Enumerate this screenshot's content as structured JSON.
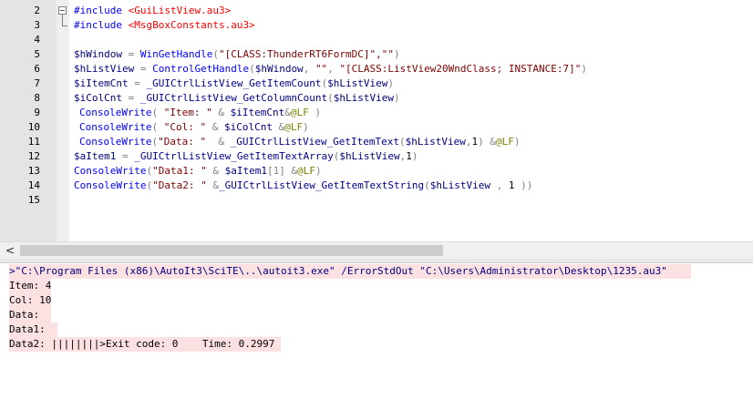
{
  "editor": {
    "line_numbers": [
      "2",
      "3",
      "4",
      "5",
      "6",
      "7",
      "8",
      "9",
      "10",
      "11",
      "12",
      "13",
      "14",
      "15"
    ],
    "lines": {
      "l2": {
        "kw": "#include",
        "sp": " ",
        "str": "<GuiListView.au3>"
      },
      "l3": {
        "kw": "#include",
        "sp": " ",
        "str": "<MsgBoxConstants.au3>"
      },
      "l5": {
        "v": "$hWindow",
        "op": " = ",
        "fn": "WinGetHandle",
        "p1": "(",
        "s": "\"[CLASS:ThunderRT6FormDC]\",\"\"",
        "p2": ")"
      },
      "l6": {
        "v": "$hListView",
        "op": " = ",
        "fn": "ControlGetHandle",
        "p1": "(",
        "v2": "$hWindow",
        "c1": ", ",
        "s1": "\"\"",
        "c2": ", ",
        "s2": "\"[CLASS:ListView20WndClass; INSTANCE:7]\"",
        "p2": ")"
      },
      "l7": {
        "v": "$iItemCnt",
        "op": " = ",
        "fn": "_GUICtrlListView_GetItemCount",
        "p1": "(",
        "v2": "$hListView",
        "p2": ")"
      },
      "l8": {
        "v": "$iColCnt",
        "op": " = ",
        "fn": "_GUICtrlListView_GetColumnCount",
        "p1": "(",
        "v2": "$hListView",
        "p2": ")"
      },
      "l9": {
        "fn": "ConsoleWrite",
        "p1": "( ",
        "s": "\"Item: \"",
        "c1": " & ",
        "v": "$iItemCnt",
        "c2": "&",
        "m": "@LF",
        "p2": " )"
      },
      "l10": {
        "fn": "ConsoleWrite",
        "p1": "( ",
        "s": "\"Col: \"",
        "c1": " & ",
        "v": "$iColCnt",
        "c2": " &",
        "m": "@LF",
        "p2": ")"
      },
      "l11": {
        "fn": "ConsoleWrite",
        "p1": "(",
        "s": "\"Data: \"",
        "c1": "  & ",
        "fn2": "_GUICtrlListView_GetItemText",
        "p3": "(",
        "v": "$hListView",
        "c3": ",",
        "n": "1",
        "p4": ")",
        "c2": " &",
        "m": "@LF",
        "p2": ")"
      },
      "l12": {
        "v": "$aItem1",
        "op": " = ",
        "fn": "_GUICtrlListView_GetItemTextArray",
        "p1": "(",
        "v2": "$hListView",
        "c1": ",",
        "n": "1",
        "p2": ")"
      },
      "l13": {
        "fn": "ConsoleWrite",
        "p1": "(",
        "s": "\"Data1: \"",
        "c1": " & ",
        "v": "$aItem1",
        "b": "[1]",
        "c2": " &",
        "m": "@LF",
        "p2": ")"
      },
      "l14": {
        "fn": "ConsoleWrite",
        "p1": "(",
        "s": "\"Data2: \"",
        "c1": " &",
        "fn2": "_GUICtrlListView_GetItemTextString",
        "p3": "(",
        "v": "$hListView",
        "c3": " , ",
        "n": "1",
        "p2": " ))"
      }
    }
  },
  "output": {
    "lines": [
      ">\"C:\\Program Files (x86)\\AutoIt3\\SciTE\\..\\autoit3.exe\" /ErrorStdOut \"C:\\Users\\Administrator\\Desktop\\1235.au3\"    ",
      "Item: 4",
      "Col: 10",
      "Data:  ",
      "Data1:  ",
      "Data2: ||||||||>Exit code: 0    Time: 0.2997 "
    ]
  },
  "scrollbar": {
    "left_arrow": "<"
  }
}
